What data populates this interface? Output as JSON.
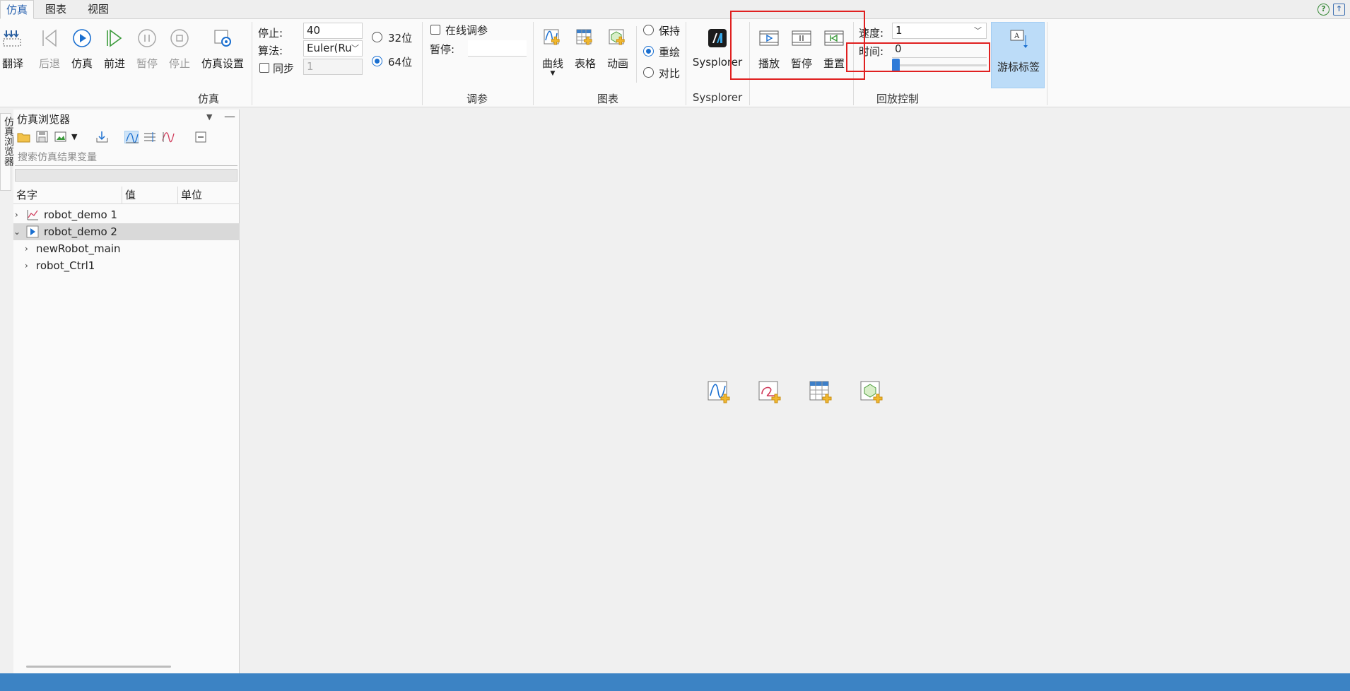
{
  "menu": {
    "tabs": [
      "仿真",
      "图表",
      "视图"
    ]
  },
  "ribbon": {
    "simulation": {
      "group_label": "仿真",
      "translate": "翻译",
      "back": "后退",
      "simulate": "仿真",
      "forward": "前进",
      "pause": "暂停",
      "stop": "停止",
      "settings": "仿真设置",
      "stop_label": "停止:",
      "stop_value": "40",
      "algo_label": "算法:",
      "algo_value": "Euler(Ru",
      "sync_label": "同步",
      "sync_value": "1",
      "bit32": "32位",
      "bit64": "64位"
    },
    "tuning": {
      "group_label": "调参",
      "online": "在线调参",
      "pause_label": "暂停:"
    },
    "charts": {
      "group_label": "图表",
      "curve": "曲线",
      "table": "表格",
      "animation": "动画",
      "keep": "保持",
      "redraw": "重绘",
      "compare": "对比"
    },
    "sysplorer": {
      "button": "Sysplorer",
      "group_label": "Sysplorer"
    },
    "playback": {
      "group_label": "回放控制",
      "play": "播放",
      "pause": "暂停",
      "reset": "重置",
      "speed_label": "速度:",
      "speed_value": "1",
      "time_label": "时间:",
      "time_value": "0",
      "cursor_label": "游标标签"
    }
  },
  "side_tab": "仿真浏览器",
  "browser": {
    "title": "仿真浏览器",
    "search_placeholder": "搜索仿真结果变量",
    "columns": [
      "名字",
      "值",
      "单位"
    ],
    "rows": [
      "robot_demo 1",
      "robot_demo 2",
      "newRobot_main",
      "robot_Ctrl1"
    ]
  },
  "colors": {
    "accent": "#2f7bd8",
    "status_bar": "#3c83c4",
    "highlight_box": "#e02020",
    "cursor_btn": "#bcdcf8"
  }
}
